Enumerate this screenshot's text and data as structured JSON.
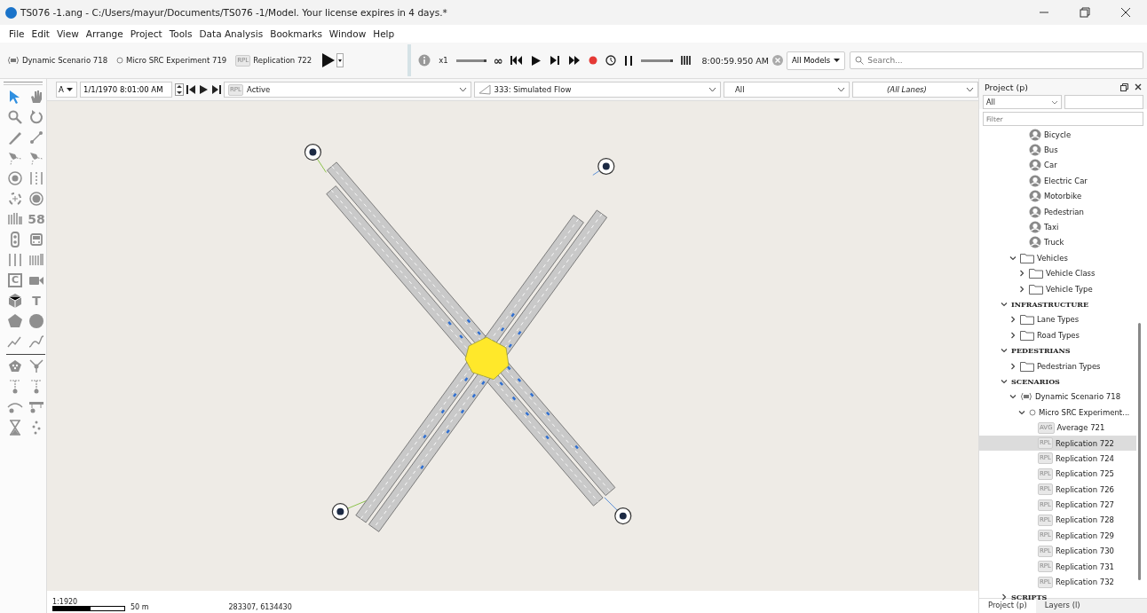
{
  "window": {
    "title": "TS076 -1.ang - C:/Users/mayur/Documents/TS076 -1/Model. Your license expires in 4 days.*"
  },
  "menu": [
    "File",
    "Edit",
    "View",
    "Arrange",
    "Project",
    "Tools",
    "Data Analysis",
    "Bookmarks",
    "Window",
    "Help"
  ],
  "toolbar": {
    "scenario": "Dynamic Scenario 718",
    "experiment": "Micro SRC Experiment 719",
    "replication_badge": "RPL",
    "replication": "Replication 722",
    "speed": "x1",
    "speed_slider": {
      "level": 1
    },
    "infinity": "∞",
    "step_slider": {
      "level": 1
    },
    "time": "8:00:59.950 AM",
    "model_filter": "All Models",
    "search": {
      "placeholder": "Search..."
    }
  },
  "palette": [
    {
      "kind": "arrow",
      "selected": true
    },
    {
      "kind": "hand",
      "selected": false
    },
    {
      "kind": "search",
      "selected": false
    },
    {
      "kind": "rotate",
      "selected": false
    },
    {
      "kind": "pen",
      "selected": false
    },
    {
      "kind": "segment",
      "selected": false
    },
    {
      "kind": "node",
      "selected": false
    },
    {
      "kind": "node",
      "selected": false
    },
    {
      "kind": "target",
      "selected": false
    },
    {
      "kind": "dashes",
      "selected": false
    },
    {
      "kind": "crosshair",
      "selected": false
    },
    {
      "kind": "ring",
      "selected": false
    },
    {
      "kind": "bars",
      "selected": false
    },
    {
      "kind": "glyph",
      "text": "58",
      "selected": false
    },
    {
      "kind": "light",
      "selected": false
    },
    {
      "kind": "bus",
      "selected": false
    },
    {
      "kind": "lines",
      "selected": false
    },
    {
      "kind": "barcode",
      "selected": false
    },
    {
      "kind": "boxglyph",
      "text": "C",
      "selected": false
    },
    {
      "kind": "camera",
      "selected": false
    },
    {
      "kind": "cube",
      "selected": false
    },
    {
      "kind": "glyph",
      "text": "T",
      "selected": false
    },
    {
      "kind": "pentagon",
      "selected": false
    },
    {
      "kind": "disc",
      "selected": false
    },
    {
      "kind": "polyline",
      "selected": false
    },
    {
      "kind": "curve",
      "selected": false
    },
    {
      "kind": "stop",
      "selected": false
    },
    {
      "kind": "junction",
      "selected": false
    },
    {
      "kind": "pin",
      "selected": false
    },
    {
      "kind": "pin",
      "selected": false
    },
    {
      "kind": "arc",
      "selected": false
    },
    {
      "kind": "sign",
      "selected": false
    },
    {
      "kind": "hourglass",
      "selected": false
    },
    {
      "kind": "dots",
      "selected": false
    }
  ],
  "view_bar": {
    "layer": "A",
    "date": "1/1/1970 8:01:00 AM",
    "replication_badge": "RPL",
    "replication_state": "Active",
    "view_mode": "333: Simulated Flow",
    "filter": "All",
    "lanes": "(All Lanes)"
  },
  "status_bar": {
    "scale": "1:1920",
    "scale_length": "50 m",
    "coordinates": "283307, 6134430"
  },
  "right_panel": {
    "title": "Project (p)",
    "filter_1": "All",
    "filter_placeholder": "Filter",
    "tree": [
      {
        "children": [
          {
            "children": [
              {
                "label": "Bicycle",
                "kind": "person"
              },
              {
                "label": "Bus",
                "kind": "person"
              },
              {
                "label": "Car",
                "kind": "person"
              },
              {
                "label": "Electric Car",
                "kind": "person"
              },
              {
                "label": "Motorbike",
                "kind": "person"
              },
              {
                "label": "Pedestrian",
                "kind": "person"
              },
              {
                "label": "Taxi",
                "kind": "person"
              },
              {
                "label": "Truck",
                "kind": "person"
              }
            ]
          },
          {
            "label": "Vehicles",
            "kind": "folder",
            "expanded": true,
            "children": [
              {
                "label": "Vehicle Class",
                "kind": "folder",
                "expanded": false
              },
              {
                "label": "Vehicle Type",
                "kind": "folder",
                "expanded": false
              }
            ]
          }
        ]
      },
      {
        "label": "INFRASTRUCTURE",
        "kind": "section",
        "expanded": true,
        "children": [
          {
            "label": "Lane Types",
            "kind": "folder",
            "expanded": false
          },
          {
            "label": "Road Types",
            "kind": "folder",
            "expanded": false
          }
        ]
      },
      {
        "label": "PEDESTRIANS",
        "kind": "section",
        "expanded": true,
        "children": [
          {
            "label": "Pedestrian Types",
            "kind": "folder",
            "expanded": false
          }
        ]
      },
      {
        "label": "SCENARIOS",
        "kind": "section",
        "expanded": true,
        "children": [
          {
            "label": "Dynamic Scenario 718",
            "kind": "scenario",
            "expanded": true,
            "children": [
              {
                "label": "Micro SRC Experiment...",
                "kind": "experiment",
                "expanded": true,
                "children": [
                  {
                    "label": "Average 721",
                    "kind": "badge",
                    "badge": "AVG",
                    "selected": false
                  },
                  {
                    "label": "Replication 722",
                    "kind": "badge",
                    "badge": "RPL",
                    "selected": true
                  },
                  {
                    "label": "Replication 724",
                    "kind": "badge",
                    "badge": "RPL",
                    "selected": false
                  },
                  {
                    "label": "Replication 725",
                    "kind": "badge",
                    "badge": "RPL",
                    "selected": false
                  },
                  {
                    "label": "Replication 726",
                    "kind": "badge",
                    "badge": "RPL",
                    "selected": false
                  },
                  {
                    "label": "Replication 727",
                    "kind": "badge",
                    "badge": "RPL",
                    "selected": false
                  },
                  {
                    "label": "Replication 728",
                    "kind": "badge",
                    "badge": "RPL",
                    "selected": false
                  },
                  {
                    "label": "Replication 729",
                    "kind": "badge",
                    "badge": "RPL",
                    "selected": false
                  },
                  {
                    "label": "Replication 730",
                    "kind": "badge",
                    "badge": "RPL",
                    "selected": false
                  },
                  {
                    "label": "Replication 731",
                    "kind": "badge",
                    "badge": "RPL",
                    "selected": false
                  },
                  {
                    "label": "Replication 732",
                    "kind": "badge",
                    "badge": "RPL",
                    "selected": false
                  }
                ]
              }
            ]
          }
        ]
      },
      {
        "label": "SCRIPTS",
        "kind": "section",
        "expanded": false
      }
    ],
    "tabs": [
      {
        "label": "Project (p)",
        "selected": true
      },
      {
        "label": "Layers (l)",
        "selected": false
      }
    ]
  }
}
